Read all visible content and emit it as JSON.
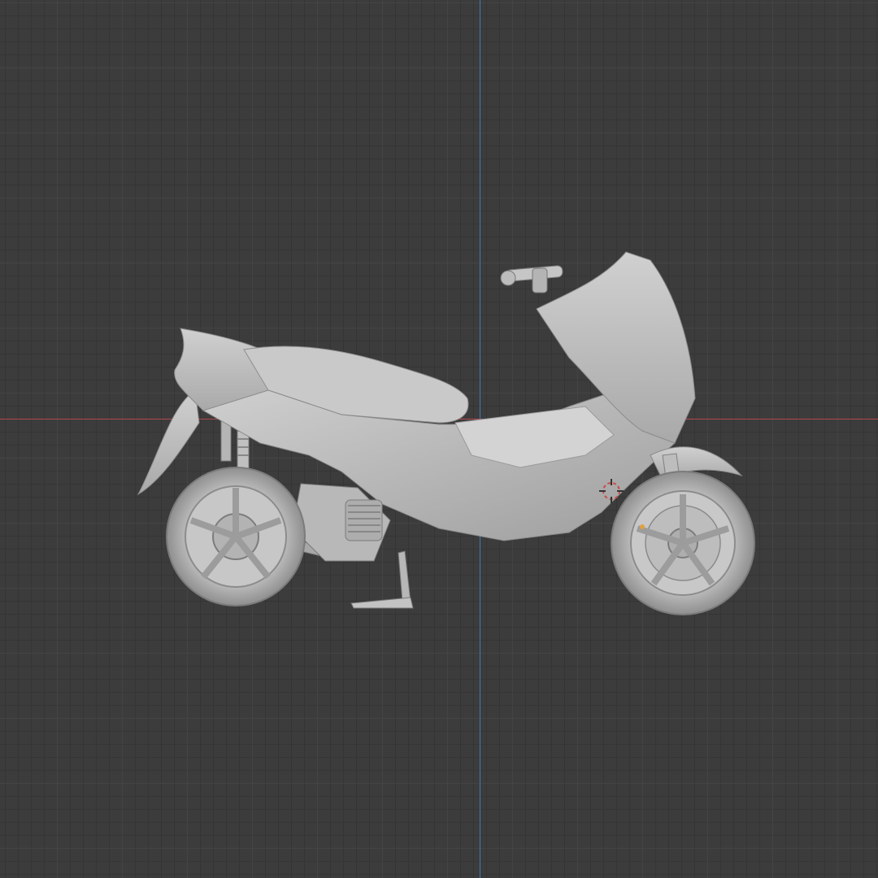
{
  "viewport": {
    "mode": "3D viewport",
    "background_color": "#3c3c3c",
    "grid_color": "#464646",
    "x_axis_color": "#b2494c",
    "y_axis_color": "#3f78b8"
  },
  "object": {
    "name_icon": "scooter-model",
    "origin_icon": "3d-cursor-icon",
    "color": "#c4c4c4"
  }
}
